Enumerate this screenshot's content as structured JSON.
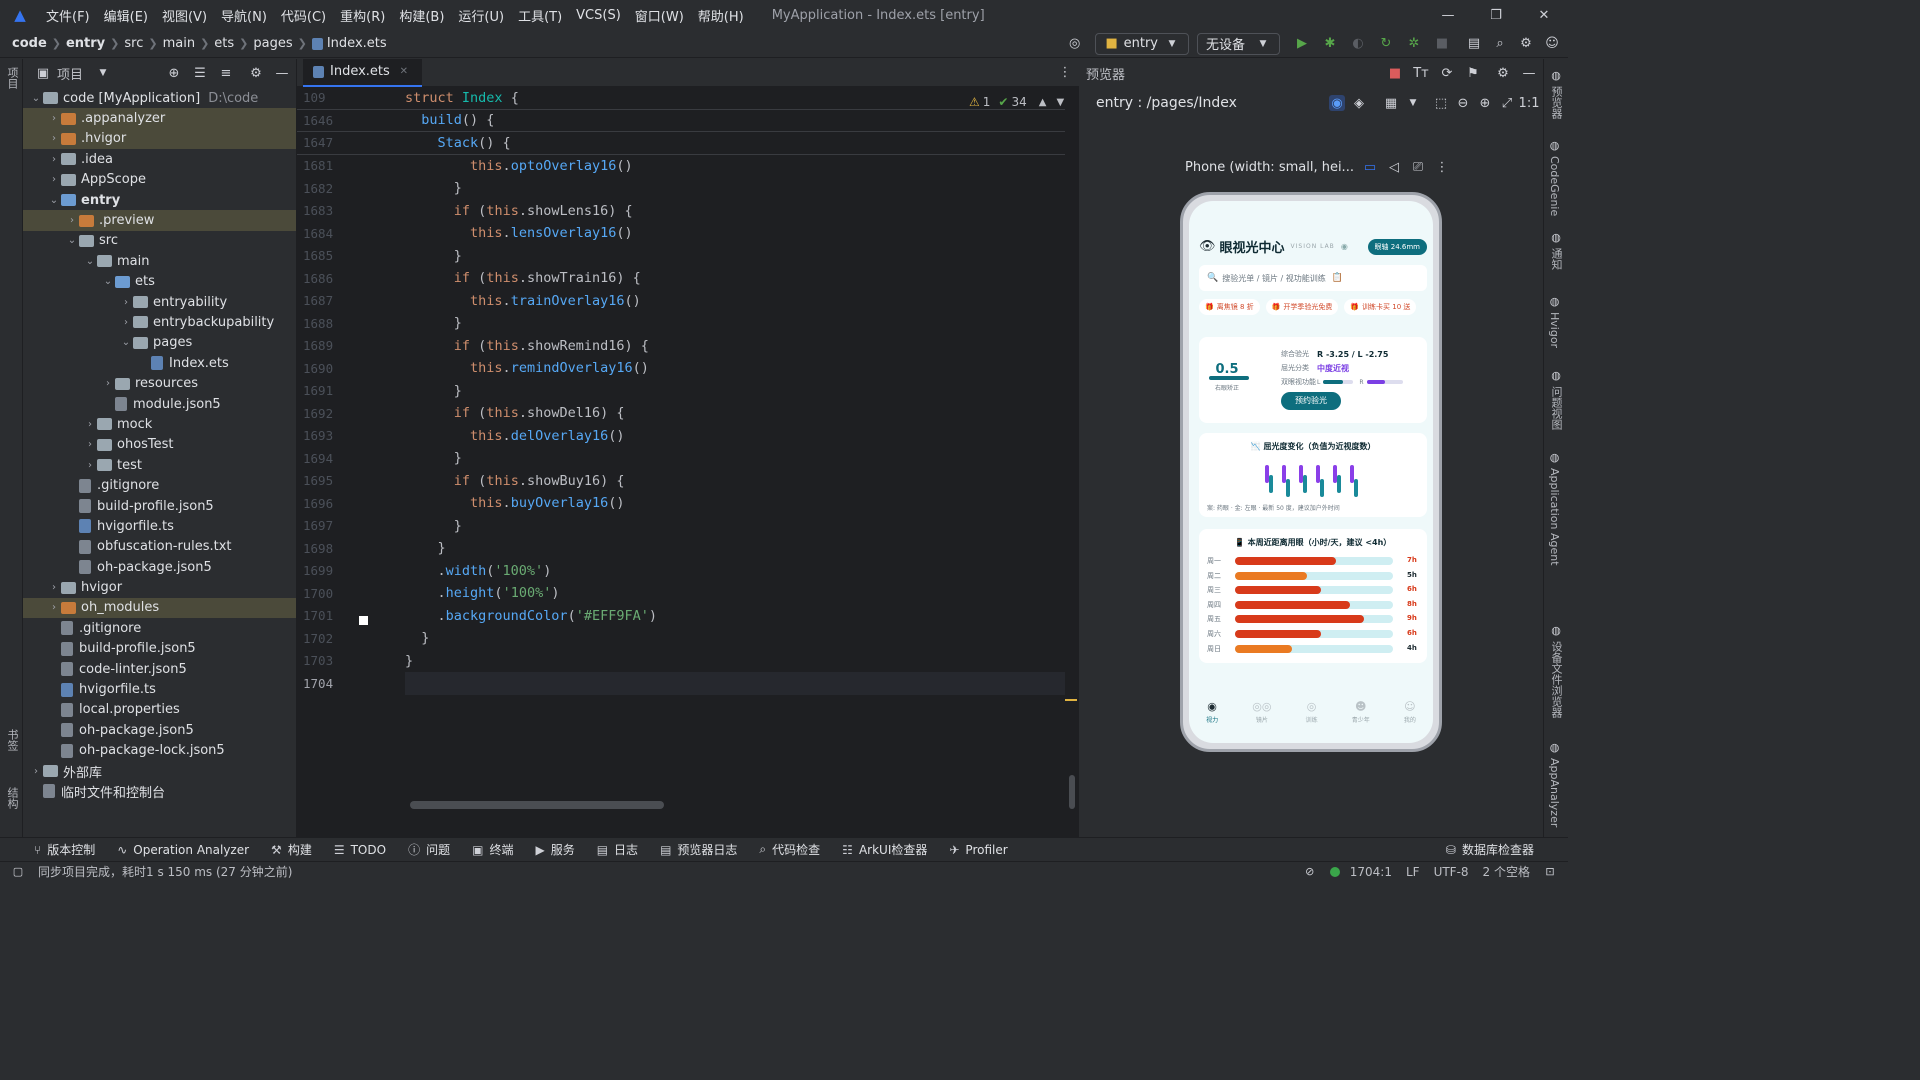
{
  "window": {
    "title": "MyApplication - Index.ets [entry]",
    "menus": [
      "文件(F)",
      "编辑(E)",
      "视图(V)",
      "导航(N)",
      "代码(C)",
      "重构(R)",
      "构建(B)",
      "运行(U)",
      "工具(T)",
      "VCS(S)",
      "窗口(W)",
      "帮助(H)"
    ]
  },
  "breadcrumb": [
    "code",
    "entry",
    "src",
    "main",
    "ets",
    "pages",
    "Index.ets"
  ],
  "toolbar": {
    "module": "entry",
    "device": "无设备"
  },
  "project": {
    "title": "项目",
    "tree": [
      {
        "depth": 0,
        "arrow": "v",
        "icon": "folder",
        "label": "code [MyApplication]",
        "note": "D:\\code"
      },
      {
        "depth": 1,
        "arrow": ">",
        "icon": "folder-orange",
        "label": ".appanalyzer",
        "hl": true
      },
      {
        "depth": 1,
        "arrow": ">",
        "icon": "folder-orange",
        "label": ".hvigor",
        "hl": true
      },
      {
        "depth": 1,
        "arrow": ">",
        "icon": "folder",
        "label": ".idea"
      },
      {
        "depth": 1,
        "arrow": ">",
        "icon": "folder",
        "label": "AppScope"
      },
      {
        "depth": 1,
        "arrow": "v",
        "icon": "folder-blue",
        "label": "entry",
        "bold": true
      },
      {
        "depth": 2,
        "arrow": ">",
        "icon": "folder-orange",
        "label": ".preview",
        "hl": true
      },
      {
        "depth": 2,
        "arrow": "v",
        "icon": "folder",
        "label": "src"
      },
      {
        "depth": 3,
        "arrow": "v",
        "icon": "folder",
        "label": "main"
      },
      {
        "depth": 4,
        "arrow": "v",
        "icon": "folder-blue",
        "label": "ets"
      },
      {
        "depth": 5,
        "arrow": ">",
        "icon": "folder",
        "label": "entryability"
      },
      {
        "depth": 5,
        "arrow": ">",
        "icon": "folder",
        "label": "entrybackupability"
      },
      {
        "depth": 5,
        "arrow": "v",
        "icon": "folder",
        "label": "pages"
      },
      {
        "depth": 6,
        "arrow": "",
        "icon": "file-code",
        "label": "Index.ets"
      },
      {
        "depth": 4,
        "arrow": ">",
        "icon": "folder",
        "label": "resources"
      },
      {
        "depth": 4,
        "arrow": "",
        "icon": "file",
        "label": "module.json5"
      },
      {
        "depth": 3,
        "arrow": ">",
        "icon": "folder",
        "label": "mock"
      },
      {
        "depth": 3,
        "arrow": ">",
        "icon": "folder",
        "label": "ohosTest"
      },
      {
        "depth": 3,
        "arrow": ">",
        "icon": "folder",
        "label": "test"
      },
      {
        "depth": 2,
        "arrow": "",
        "icon": "file",
        "label": ".gitignore"
      },
      {
        "depth": 2,
        "arrow": "",
        "icon": "file",
        "label": "build-profile.json5"
      },
      {
        "depth": 2,
        "arrow": "",
        "icon": "file-code",
        "label": "hvigorfile.ts"
      },
      {
        "depth": 2,
        "arrow": "",
        "icon": "file",
        "label": "obfuscation-rules.txt"
      },
      {
        "depth": 2,
        "arrow": "",
        "icon": "file",
        "label": "oh-package.json5"
      },
      {
        "depth": 1,
        "arrow": ">",
        "icon": "folder",
        "label": "hvigor"
      },
      {
        "depth": 1,
        "arrow": ">",
        "icon": "folder-orange",
        "label": "oh_modules",
        "hl": true
      },
      {
        "depth": 1,
        "arrow": "",
        "icon": "file",
        "label": ".gitignore"
      },
      {
        "depth": 1,
        "arrow": "",
        "icon": "file",
        "label": "build-profile.json5"
      },
      {
        "depth": 1,
        "arrow": "",
        "icon": "file",
        "label": "code-linter.json5"
      },
      {
        "depth": 1,
        "arrow": "",
        "icon": "file-code",
        "label": "hvigorfile.ts"
      },
      {
        "depth": 1,
        "arrow": "",
        "icon": "file",
        "label": "local.properties"
      },
      {
        "depth": 1,
        "arrow": "",
        "icon": "file",
        "label": "oh-package.json5"
      },
      {
        "depth": 1,
        "arrow": "",
        "icon": "file",
        "label": "oh-package-lock.json5"
      },
      {
        "depth": 0,
        "arrow": ">",
        "icon": "lib",
        "label": "外部库"
      },
      {
        "depth": 0,
        "arrow": "",
        "icon": "scratch",
        "label": "临时文件和控制台"
      }
    ]
  },
  "editor": {
    "tab": "Index.ets",
    "warnings": "1",
    "checks": "34",
    "lines": [
      {
        "n": "109",
        "sticky": true,
        "tokens": [
          [
            "kw",
            "struct "
          ],
          [
            "ty",
            "Index "
          ],
          [
            "plain",
            "{"
          ]
        ]
      },
      {
        "n": "1646",
        "sticky": true,
        "tokens": [
          [
            "plain",
            "  "
          ],
          [
            "fn",
            "build"
          ],
          [
            "plain",
            "() {"
          ]
        ]
      },
      {
        "n": "1647",
        "sticky": true,
        "tokens": [
          [
            "plain",
            "    "
          ],
          [
            "fn",
            "Stack"
          ],
          [
            "plain",
            "() {"
          ]
        ]
      },
      {
        "n": "1681",
        "tokens": [
          [
            "plain",
            "        "
          ],
          [
            "this",
            "this"
          ],
          [
            "plain",
            "."
          ],
          [
            "fn",
            "optoOverlay16"
          ],
          [
            "plain",
            "()"
          ]
        ]
      },
      {
        "n": "1682",
        "tokens": [
          [
            "plain",
            "      }"
          ]
        ]
      },
      {
        "n": "1683",
        "tokens": [
          [
            "plain",
            "      "
          ],
          [
            "kw",
            "if "
          ],
          [
            "plain",
            "("
          ],
          [
            "this",
            "this"
          ],
          [
            "plain",
            ".showLens16) {"
          ]
        ]
      },
      {
        "n": "1684",
        "tokens": [
          [
            "plain",
            "        "
          ],
          [
            "this",
            "this"
          ],
          [
            "plain",
            "."
          ],
          [
            "fn",
            "lensOverlay16"
          ],
          [
            "plain",
            "()"
          ]
        ]
      },
      {
        "n": "1685",
        "tokens": [
          [
            "plain",
            "      }"
          ]
        ]
      },
      {
        "n": "1686",
        "tokens": [
          [
            "plain",
            "      "
          ],
          [
            "kw",
            "if "
          ],
          [
            "plain",
            "("
          ],
          [
            "this",
            "this"
          ],
          [
            "plain",
            ".showTrain16) {"
          ]
        ]
      },
      {
        "n": "1687",
        "tokens": [
          [
            "plain",
            "        "
          ],
          [
            "this",
            "this"
          ],
          [
            "plain",
            "."
          ],
          [
            "fn",
            "trainOverlay16"
          ],
          [
            "plain",
            "()"
          ]
        ]
      },
      {
        "n": "1688",
        "tokens": [
          [
            "plain",
            "      }"
          ]
        ]
      },
      {
        "n": "1689",
        "tokens": [
          [
            "plain",
            "      "
          ],
          [
            "kw",
            "if "
          ],
          [
            "plain",
            "("
          ],
          [
            "this",
            "this"
          ],
          [
            "plain",
            ".showRemind16) {"
          ]
        ]
      },
      {
        "n": "1690",
        "tokens": [
          [
            "plain",
            "        "
          ],
          [
            "this",
            "this"
          ],
          [
            "plain",
            "."
          ],
          [
            "fn",
            "remindOverlay16"
          ],
          [
            "plain",
            "()"
          ]
        ]
      },
      {
        "n": "1691",
        "tokens": [
          [
            "plain",
            "      }"
          ]
        ]
      },
      {
        "n": "1692",
        "tokens": [
          [
            "plain",
            "      "
          ],
          [
            "kw",
            "if "
          ],
          [
            "plain",
            "("
          ],
          [
            "this",
            "this"
          ],
          [
            "plain",
            ".showDel16) {"
          ]
        ]
      },
      {
        "n": "1693",
        "tokens": [
          [
            "plain",
            "        "
          ],
          [
            "this",
            "this"
          ],
          [
            "plain",
            "."
          ],
          [
            "fn",
            "delOverlay16"
          ],
          [
            "plain",
            "()"
          ]
        ]
      },
      {
        "n": "1694",
        "tokens": [
          [
            "plain",
            "      }"
          ]
        ]
      },
      {
        "n": "1695",
        "tokens": [
          [
            "plain",
            "      "
          ],
          [
            "kw",
            "if "
          ],
          [
            "plain",
            "("
          ],
          [
            "this",
            "this"
          ],
          [
            "plain",
            ".showBuy16) {"
          ]
        ]
      },
      {
        "n": "1696",
        "tokens": [
          [
            "plain",
            "        "
          ],
          [
            "this",
            "this"
          ],
          [
            "plain",
            "."
          ],
          [
            "fn",
            "buyOverlay16"
          ],
          [
            "plain",
            "()"
          ]
        ]
      },
      {
        "n": "1697",
        "tokens": [
          [
            "plain",
            "      }"
          ]
        ]
      },
      {
        "n": "1698",
        "tokens": [
          [
            "plain",
            "    }"
          ]
        ]
      },
      {
        "n": "1699",
        "tokens": [
          [
            "plain",
            "    ."
          ],
          [
            "fn",
            "width"
          ],
          [
            "plain",
            "("
          ],
          [
            "str",
            "'100%'"
          ],
          [
            "plain",
            ")"
          ]
        ]
      },
      {
        "n": "1700",
        "tokens": [
          [
            "plain",
            "    ."
          ],
          [
            "fn",
            "height"
          ],
          [
            "plain",
            "("
          ],
          [
            "str",
            "'100%'"
          ],
          [
            "plain",
            ")"
          ]
        ]
      },
      {
        "n": "1701",
        "tokens": [
          [
            "plain",
            "    ."
          ],
          [
            "fn",
            "backgroundColor"
          ],
          [
            "plain",
            "("
          ],
          [
            "str",
            "'#EFF9FA'"
          ],
          [
            "plain",
            ")"
          ]
        ]
      },
      {
        "n": "1702",
        "tokens": [
          [
            "plain",
            "  }"
          ]
        ]
      },
      {
        "n": "1703",
        "tokens": [
          [
            "plain",
            "}"
          ]
        ]
      },
      {
        "n": "1704",
        "current": true,
        "tokens": [
          [
            "plain",
            ""
          ]
        ]
      }
    ]
  },
  "preview": {
    "title": "预览器",
    "route": "entry : /pages/Index",
    "device_label": "Phone (width: small, hei...",
    "app": {
      "title": "眼视光中心",
      "subtitle": "VISION LAB",
      "badge": "眼轴 24.6mm",
      "search": "搜验光单 / 镜片 / 视功能训练",
      "promos": [
        "离焦镜 8 折",
        "开学季验光免费",
        "训练卡买 10 送"
      ],
      "acuity": "0.5",
      "acuity_label": "右眼矫正",
      "refraction_label": "综合验光",
      "refraction_value": "R -3.25 / L -2.75",
      "class_label": "屈光分类",
      "class_value": "中度近视",
      "binocular_label": "双眼视功能",
      "binocular_l": "L",
      "binocular_r": "R",
      "book_button": "预约验光",
      "chart1_title": "屈光度变化（负值为近视度数）",
      "chart1_caption": "案: 药眼 · 金: 左眼 · 最新 50 度，建议加户外时间",
      "chart2_title": "本周近距离用眼（小时/天，建议 <4h）",
      "tabs": [
        "视力",
        "镜片",
        "训练",
        "青少年",
        "我的"
      ]
    }
  },
  "chart_data": {
    "type": "bar",
    "title": "本周近距离用眼（小时/天，建议 <4h）",
    "categories": [
      "周一",
      "周二",
      "周三",
      "周四",
      "周五",
      "周六",
      "周日"
    ],
    "values": [
      7,
      5,
      6,
      8,
      9,
      6,
      4
    ],
    "value_labels": [
      "7h",
      "5h",
      "6h",
      "8h",
      "9h",
      "6h",
      "4h"
    ],
    "xlim": [
      0,
      11
    ],
    "colors": {
      "high": "#d83a1a",
      "low": "#ea7a22",
      "track": "#cfeef2"
    }
  },
  "bottom_tools": [
    "版本控制",
    "Operation Analyzer",
    "构建",
    "TODO",
    "问题",
    "终端",
    "服务",
    "日志",
    "预览器日志",
    "代码检查",
    "ArkUI检查器",
    "Profiler"
  ],
  "bottom_right_tool": "数据库检查器",
  "status": {
    "message": "同步项目完成，耗时1 s 150 ms (27 分钟之前)",
    "position": "1704:1",
    "line_sep": "LF",
    "encoding": "UTF-8",
    "indent": "2 个空格"
  },
  "right_tools": [
    "预览器",
    "CodeGenie",
    "通知",
    "Hvigor",
    "问题视图",
    "Application Agent",
    "设备文件浏览器",
    "AppAnalyzer"
  ],
  "left_tools": [
    "项目",
    "书签",
    "结构"
  ]
}
